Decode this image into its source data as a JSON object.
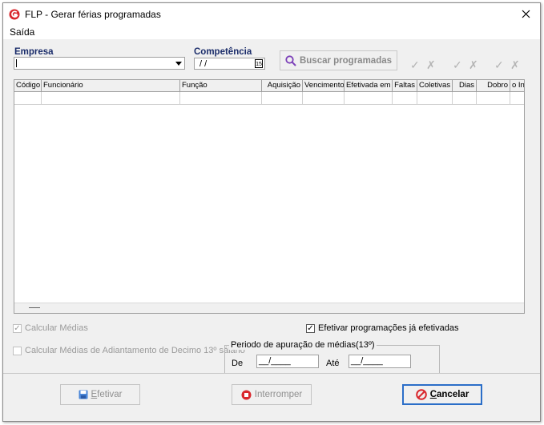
{
  "window": {
    "title": "FLP - Gerar férias programadas"
  },
  "menu": {
    "items": [
      "Saída"
    ]
  },
  "filters": {
    "empresa_label": "Empresa",
    "empresa_value": "",
    "competencia_label": "Competência",
    "competencia_value": "/ /",
    "calendar_glyph": "15"
  },
  "toolbar": {
    "search_label": "Buscar programadas"
  },
  "grid": {
    "columns": [
      "Código",
      "Funcionário",
      "Função",
      "Aquisição",
      "Vencimento",
      "Efetivada em",
      "Faltas",
      "Coletivas",
      "Dias",
      "Dobro",
      "o In"
    ]
  },
  "options": {
    "calc_medias": "Calcular Médias",
    "calc_medias_adiant": "Calcular Médias de Adiantamento de Decimo 13º sálario",
    "efetivar_efetivadas": "Efetivar programações já efetivadas"
  },
  "periodo": {
    "title": "Periodo de apuração de médias(13º)",
    "de_label": "De",
    "de_value": "__/____",
    "ate_label": "Até",
    "ate_value": "__/____"
  },
  "buttons": {
    "efetivar_rest": "fetivar",
    "interromper": "Interromper",
    "cancelar_rest": "ancelar"
  },
  "colors": {
    "accent": "#2b6ec8",
    "label_blue": "#1a2c6a",
    "icon_red": "#d9262c"
  }
}
